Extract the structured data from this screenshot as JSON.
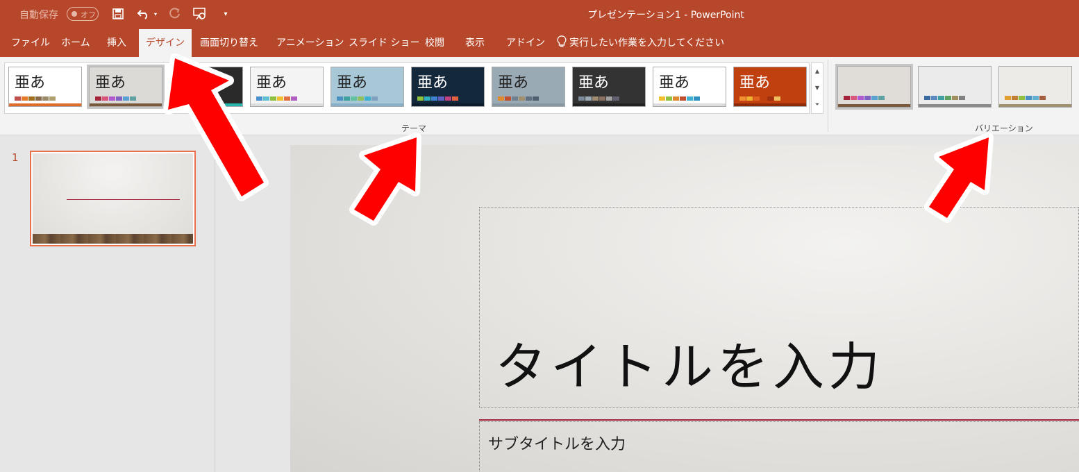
{
  "titlebar": {
    "autosave_label": "自動保存",
    "autosave_state": "オフ",
    "title": "プレゼンテーション1  -  PowerPoint",
    "icons": [
      "save-icon",
      "undo-icon",
      "redo-icon",
      "presenter-icon",
      "customize-qat-icon"
    ]
  },
  "tabs": [
    "ファイル",
    "ホーム",
    "挿入",
    "デザイン",
    "画面切り替え",
    "アニメーション",
    "スライド ショー",
    "校閲",
    "表示",
    "アドイン"
  ],
  "active_tab": "デザイン",
  "tell_me": "実行したい作業を入力してください",
  "ribbon": {
    "themes_group_label": "テーマ",
    "variations_group_label": "バリエーション",
    "theme_glyph": "亜あ",
    "themes": [
      {
        "bg": "#ffffff",
        "bar": "#e06c2a",
        "swatches": [
          "#c0504d",
          "#e47a2a",
          "#a07020",
          "#8a6a48",
          "#9a8a6a",
          "#b0a070"
        ]
      },
      {
        "bg": "#dcdad6",
        "bar": "#7a5a3a",
        "swatches": [
          "#a4243b",
          "#d7567a",
          "#b05ad0",
          "#8060c0",
          "#5aa0d0",
          "#60a0a0"
        ],
        "selected": true
      },
      {
        "bg": "#2a2a2a",
        "bar": "#22b8b0",
        "swatches": [
          "#22b8b0",
          "#e04a4a",
          "#f09030",
          "#90c040",
          "#4a90d0",
          "#b050c0"
        ]
      },
      {
        "bg": "#f4f4f4",
        "bar": "#dddddd",
        "swatches": [
          "#4a90d0",
          "#60c0d0",
          "#90c040",
          "#f0c030",
          "#e07040",
          "#b060c0"
        ]
      },
      {
        "bg": "#a8c8d8",
        "bar": "#88b0c8",
        "swatches": [
          "#4a90c0",
          "#40a0a0",
          "#60c0a0",
          "#90c060",
          "#40b0d0",
          "#80a0c0"
        ]
      },
      {
        "bg": "#14283c",
        "bar": "#0c1c2c",
        "swatches": [
          "#90c040",
          "#30b0c0",
          "#4080d0",
          "#6060c0",
          "#c04080",
          "#e06040"
        ]
      },
      {
        "bg": "#9aaab4",
        "bar": "#8898a2",
        "swatches": [
          "#e08a30",
          "#c05030",
          "#708090",
          "#a09070",
          "#607080",
          "#506070"
        ]
      },
      {
        "bg": "#333333",
        "bar": "#222222",
        "swatches": [
          "#7a8a9a",
          "#9aaab4",
          "#a08a70",
          "#8a7060",
          "#a0a0a0",
          "#606070"
        ]
      },
      {
        "bg": "#ffffff",
        "bar": "#dddddd",
        "swatches": [
          "#f0c030",
          "#90c040",
          "#e08a30",
          "#c05030",
          "#40b0d0",
          "#3090c0"
        ]
      },
      {
        "bg": "#c04010",
        "bar": "#8a2a08",
        "swatches": [
          "#f09030",
          "#f0b030",
          "#e06020",
          "#c04010",
          "#a03010",
          "#f0c060"
        ]
      }
    ],
    "variations": [
      {
        "bg": "#e0ddd8",
        "bar": "#7a5a3a",
        "swatches": [
          "#a4243b",
          "#d7567a",
          "#b05ad0",
          "#8060c0",
          "#5aa0d0",
          "#60a0a0"
        ],
        "selected": true
      },
      {
        "bg": "#ebebeb",
        "bar": "#8a8a8a",
        "swatches": [
          "#3a6aa0",
          "#5a8ac0",
          "#40a0a0",
          "#60a060",
          "#a09060",
          "#808080"
        ]
      },
      {
        "bg": "#ecebe8",
        "bar": "#a09070",
        "swatches": [
          "#e0a030",
          "#c08030",
          "#90c040",
          "#4a90c0",
          "#60b0d0",
          "#a06040"
        ]
      }
    ]
  },
  "slides_panel": {
    "slide_number": "1"
  },
  "slide": {
    "title_placeholder": "タイトルを入力",
    "subtitle_placeholder": "サブタイトルを入力"
  },
  "colors": {
    "accent": "#b7472a",
    "ribbon": "#f3f3f3",
    "arrow": "#ff0000",
    "theme_line": "#a4243b"
  }
}
